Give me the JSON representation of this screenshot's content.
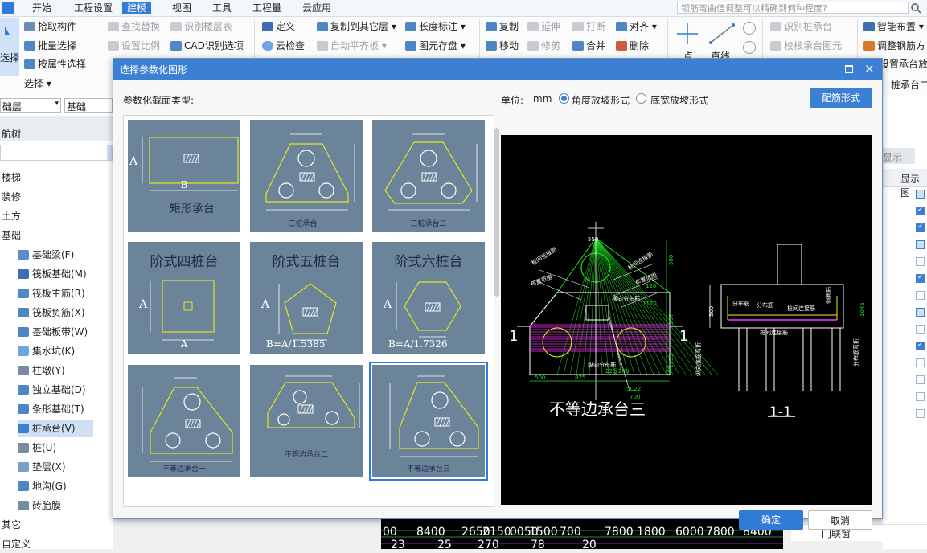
{
  "menu": [
    "开始",
    "工程设置",
    "建模",
    "视图",
    "工具",
    "工程量",
    "云应用"
  ],
  "search_placeholder": "钢筋弯曲值调整可以精确到何种程度?",
  "ribbon": {
    "select_big": "选择",
    "pick": "拾取构件",
    "batch": "批量选择",
    "by_attr": "按属性选择",
    "select_group": "选择",
    "find_replace": "查找替换",
    "set_scale": "设置比例",
    "recog_floor": "识别楼层表",
    "cad_recog": "CAD识别选项",
    "define": "定义",
    "cloud_check": "云检查",
    "copy_to_floor": "复制到其它层",
    "auto_level": "自动平齐板",
    "length_mark": "长度标注",
    "elem_save": "图元存盘",
    "copy": "复制",
    "move": "移动",
    "extend": "延伸",
    "trim": "修剪",
    "break": "打断",
    "merge": "合并",
    "align": "对齐",
    "delete": "删除",
    "point": "点",
    "line": "直线",
    "recog_cap": "识别桩承台",
    "check_cap": "校核承台图元",
    "smart_layout": "智能布置",
    "adjust_rebar": "调整钢筋方",
    "set_slope": "设置承台放",
    "cap_tab": "桩承台二"
  },
  "left": {
    "floor": "础层",
    "base": "基础",
    "nav_title": "航树",
    "items": [
      "楼梯",
      "装修",
      "土方",
      "基础"
    ],
    "sub_items": [
      "基础梁(F)",
      "筏板基础(M)",
      "筏板主筋(R)",
      "筏板负筋(X)",
      "基础板带(W)",
      "集水坑(K)",
      "柱墩(Y)",
      "独立基础(D)",
      "条形基础(T)",
      "桩承台(V)",
      "桩(U)",
      "垫层(X)",
      "地沟(G)",
      "砖胎膜"
    ],
    "bottom_items": [
      "其它",
      "自定义"
    ]
  },
  "right": {
    "tab": "显示",
    "col": "显示图",
    "door_row": "门联窗"
  },
  "dialog": {
    "title": "选择参数化图形",
    "type_label": "参数化截面类型:",
    "unit_label": "单位:",
    "unit_value": "mm",
    "radio_angle": "角度放坡形式",
    "radio_width": "底宽放坡形式",
    "rebar_button": "配筋形式",
    "ok": "确定",
    "cancel": "取消",
    "thumbs": [
      {
        "label": "矩形承台",
        "a": "A",
        "b": "B"
      },
      {
        "label": "三桩承台一"
      },
      {
        "label": "三桩承台二"
      },
      {
        "label": "阶式四桩台",
        "a": "A",
        "b": "A"
      },
      {
        "label": "阶式五桩台",
        "a": "A",
        "b": "B=A/1.5385"
      },
      {
        "label": "阶式六桩台",
        "a": "A",
        "b": "B=A/1.7326"
      },
      {
        "label": "不等边承台一"
      },
      {
        "label": "不等边承台二"
      },
      {
        "label": "不等边承台三"
      }
    ],
    "preview": {
      "title": "不等边承台三",
      "section": "1-1",
      "mark_left": "1",
      "mark_right": "1",
      "labels": [
        "桩间连接筋",
        "桩间连接筋",
        "布置范围",
        "布置范围",
        "横向分布筋",
        "纵向分布筋",
        "分布筋",
        "分布筋",
        "桩间连接筋",
        "桩间连接筋",
        "侧面筋",
        "纵向底筋弯折",
        "分布筋弯折"
      ],
      "dims": [
        "550",
        "500",
        "1397",
        "1133",
        "1120",
        "500",
        "500",
        "875",
        "700",
        "500",
        "22@200",
        "5C22",
        "120",
        "1045"
      ]
    }
  },
  "cad_strip": {
    "row1": [
      "00",
      "8400",
      "2650",
      "2150",
      "0050",
      "1500",
      "700",
      "7800",
      "1800",
      "6000",
      "7800",
      "8400"
    ],
    "row2": [
      "23",
      "25",
      "270",
      "78",
      "20"
    ]
  }
}
